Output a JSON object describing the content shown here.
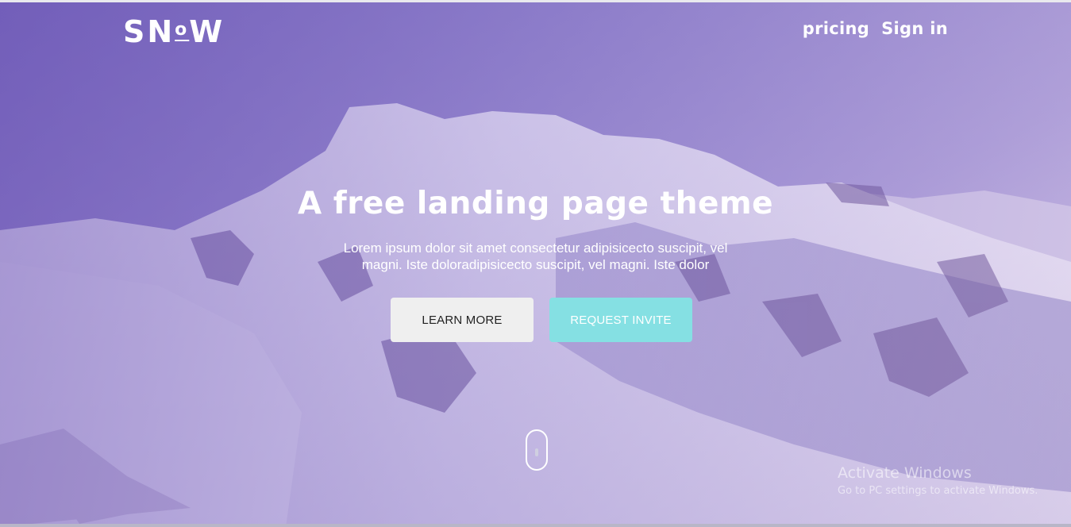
{
  "brand": {
    "logo_text_left": "SN",
    "logo_text_o": "o",
    "logo_text_right": "W"
  },
  "nav": {
    "items": [
      {
        "label": "pricing"
      },
      {
        "label": "Sign in"
      }
    ]
  },
  "hero": {
    "headline": "A free landing page theme",
    "subtext": "Lorem ipsum dolor sit amet consectetur adipisicecto suscipit, vel magni. Iste doloradipisicecto suscipit, vel magni. Iste dolor",
    "buttons": {
      "learn_more": "LEARN MORE",
      "request_invite": "REQUEST INVITE"
    }
  },
  "scroll_indicator": {
    "icon": "mouse-scroll-icon"
  },
  "watermark": {
    "title": "Activate Windows",
    "subtitle": "Go to PC settings to activate Windows."
  },
  "colors": {
    "accent": "#85e0e3",
    "button_light": "#efefef",
    "tint": "#6950b4"
  }
}
